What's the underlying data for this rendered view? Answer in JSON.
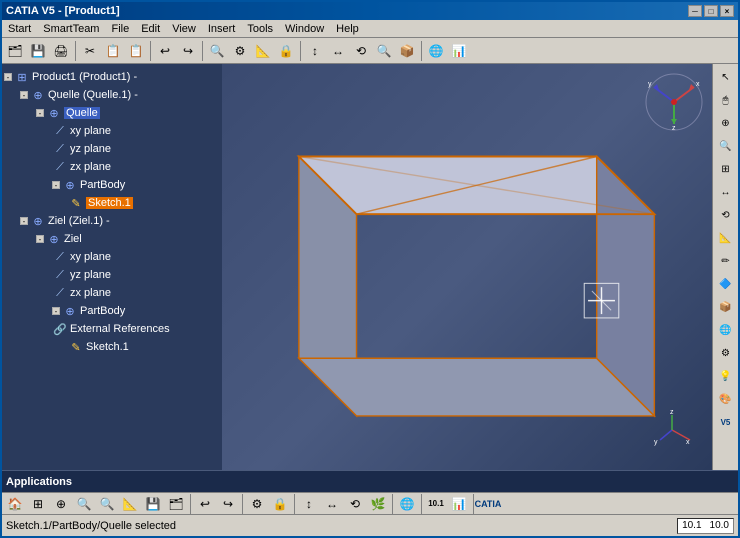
{
  "window": {
    "title": "CATIA V5 - [Product1]",
    "title_buttons": [
      "-",
      "□",
      "×"
    ]
  },
  "menu": {
    "items": [
      "Start",
      "SmartTeam",
      "File",
      "Edit",
      "View",
      "Insert",
      "Tools",
      "Window",
      "Help"
    ]
  },
  "tree": {
    "items": [
      {
        "id": "product1",
        "label": "Product1 (Product1) -",
        "indent": 0,
        "icon": "product",
        "expanded": true
      },
      {
        "id": "quelle1",
        "label": "Quelle (Quelle.1) -",
        "indent": 1,
        "icon": "part",
        "expanded": true
      },
      {
        "id": "quelle",
        "label": "Quelle",
        "indent": 2,
        "icon": "part",
        "highlighted": "blue",
        "expanded": true
      },
      {
        "id": "xy_plane_1",
        "label": "xy plane",
        "indent": 3,
        "icon": "plane"
      },
      {
        "id": "yz_plane_1",
        "label": "yz plane",
        "indent": 3,
        "icon": "plane"
      },
      {
        "id": "zx_plane_1",
        "label": "zx plane",
        "indent": 3,
        "icon": "plane"
      },
      {
        "id": "partbody1",
        "label": "PartBody",
        "indent": 3,
        "icon": "partbody"
      },
      {
        "id": "sketch1_q",
        "label": "Sketch.1",
        "indent": 4,
        "icon": "sketch",
        "highlighted": "orange"
      },
      {
        "id": "ziel1",
        "label": "Ziel (Ziel.1) -",
        "indent": 1,
        "icon": "part",
        "expanded": true
      },
      {
        "id": "ziel",
        "label": "Ziel",
        "indent": 2,
        "icon": "part",
        "expanded": true
      },
      {
        "id": "xy_plane_2",
        "label": "xy plane",
        "indent": 3,
        "icon": "plane"
      },
      {
        "id": "yz_plane_2",
        "label": "yz plane",
        "indent": 3,
        "icon": "plane"
      },
      {
        "id": "zx_plane_2",
        "label": "zx plane",
        "indent": 3,
        "icon": "plane"
      },
      {
        "id": "partbody2",
        "label": "PartBody",
        "indent": 3,
        "icon": "partbody"
      },
      {
        "id": "extref",
        "label": "External References",
        "indent": 3,
        "icon": "extref"
      },
      {
        "id": "sketch1_z",
        "label": "Sketch.1",
        "indent": 4,
        "icon": "sketch"
      }
    ]
  },
  "applications_bar": {
    "label": "Applications"
  },
  "status_bar": {
    "left": "Sketch.1/PartBody/Quelle selected",
    "coords_x": "10.1",
    "coords_y": "10.0"
  },
  "icons": {
    "expand": "+",
    "collapse": "-",
    "plane": "⟋",
    "product": "⊞",
    "partbody": "⚙",
    "sketch": "✎",
    "extref": "↗"
  },
  "colors": {
    "background": "#2a3a5c",
    "tree_bg": "#2a3a5c",
    "tree_text": "#ffffff",
    "highlight_orange": "#e87000",
    "highlight_blue": "#3a5fc0",
    "menu_bg": "#d4d0c8",
    "toolbar_bg": "#d4d0c8",
    "title_bg": "#003a7d",
    "box_face_top": "#c8ccdc",
    "box_face_front": "#9098b0",
    "box_face_side": "#7880a0",
    "box_edge_orange": "#cc6600"
  }
}
